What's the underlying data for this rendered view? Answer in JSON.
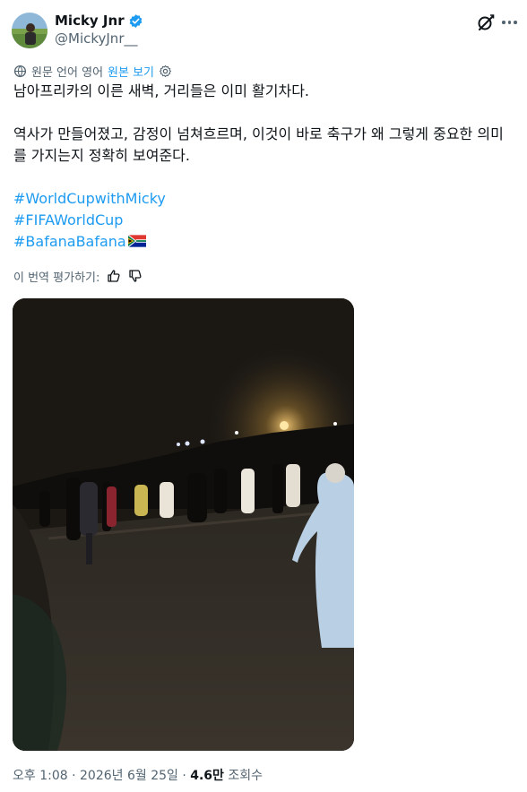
{
  "author": {
    "display_name": "Micky Jnr",
    "handle": "@MickyJnr__",
    "verified": true
  },
  "header": {
    "grok_icon": "grok-icon",
    "more_icon": "more-icon"
  },
  "translation": {
    "notice": "원문 언어 영어",
    "show_original": "원본 보기",
    "settings_icon": "gear-icon"
  },
  "tweet": {
    "line1": "남아프리카의 이른 새벽, 거리들은 이미 활기차다.",
    "line2": "역사가 만들어졌고, 감정이 넘쳐흐르며, 이것이 바로 축구가 왜 그렇게 중요한 의미",
    "line3": "를 가지는지 정확히 보여준다.",
    "hashtags": [
      "#WorldCupwithMicky",
      "#FIFAWorldCup",
      "#BafanaBafana"
    ],
    "flag_icon": "south-africa-flag-icon"
  },
  "rate": {
    "label": "이 번역 평가하기:",
    "like_icon": "thumbs-up-icon",
    "dislike_icon": "thumbs-down-icon"
  },
  "media": {
    "type": "video",
    "description_icon": "video-frame"
  },
  "meta": {
    "time_date": "오후 1:08 · 2026년 6월 25일 · ",
    "views": "4.6만",
    "views_label": " 조회수"
  },
  "colors": {
    "link": "#1d9bf0",
    "secondary_text": "#536471",
    "primary_text": "#0f1419",
    "verified": "#1d9bf0"
  }
}
